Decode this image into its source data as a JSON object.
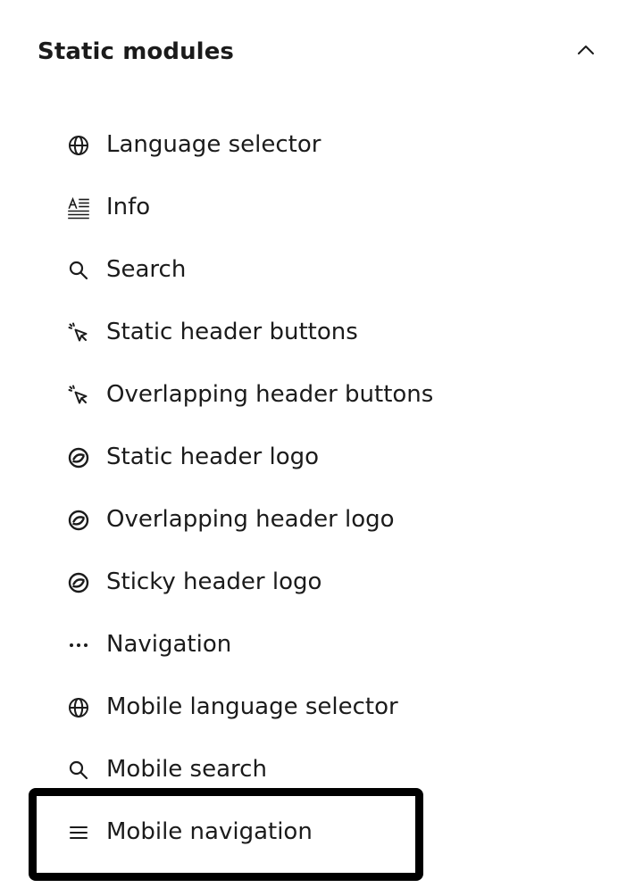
{
  "section": {
    "title": "Static modules",
    "expanded": true,
    "toggle_icon": "chevron-up-icon"
  },
  "modules": [
    {
      "label": "Language selector",
      "icon": "globe-icon"
    },
    {
      "label": "Info",
      "icon": "text-info-icon"
    },
    {
      "label": "Search",
      "icon": "search-icon"
    },
    {
      "label": "Static header buttons",
      "icon": "pointer-click-icon"
    },
    {
      "label": "Overlapping header buttons",
      "icon": "pointer-click-icon"
    },
    {
      "label": "Static header logo",
      "icon": "logo-badge-icon"
    },
    {
      "label": "Overlapping header logo",
      "icon": "logo-badge-icon"
    },
    {
      "label": "Sticky header logo",
      "icon": "logo-badge-icon"
    },
    {
      "label": "Navigation",
      "icon": "more-horizontal-icon"
    },
    {
      "label": "Mobile language selector",
      "icon": "globe-icon"
    },
    {
      "label": "Mobile search",
      "icon": "search-icon"
    },
    {
      "label": "Mobile navigation",
      "icon": "hamburger-menu-icon",
      "selected": true
    }
  ],
  "colors": {
    "text": "#1b1b1b",
    "focus_frame": "#000000",
    "background": "#ffffff"
  }
}
